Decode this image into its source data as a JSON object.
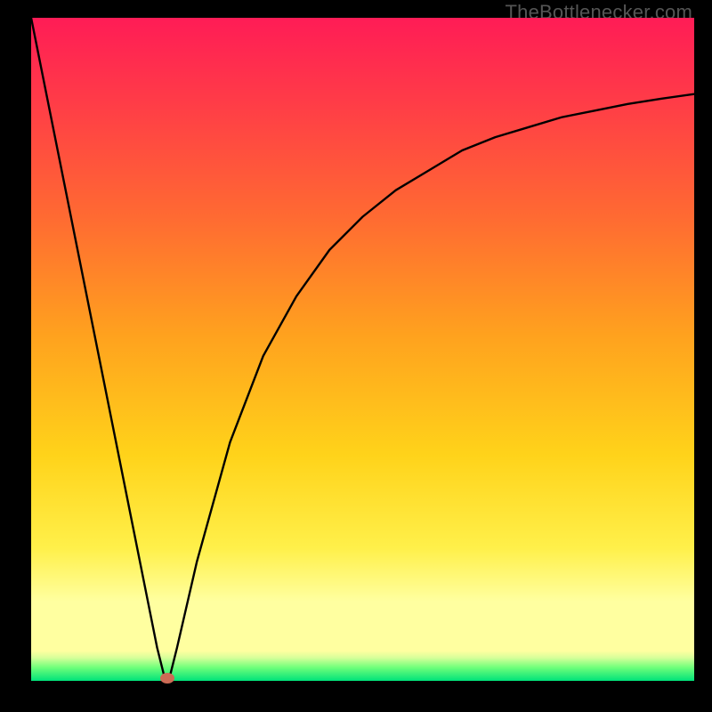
{
  "watermark": "TheBottlenecker.com",
  "chart_data": {
    "type": "line",
    "title": "",
    "xlabel": "",
    "ylabel": "",
    "xlim": [
      0,
      100
    ],
    "ylim": [
      0,
      100
    ],
    "series": [
      {
        "name": "bottleneck-curve",
        "x": [
          0,
          5,
          10,
          15,
          18,
          19,
          20,
          20.5,
          21,
          22,
          25,
          30,
          35,
          40,
          45,
          50,
          55,
          60,
          65,
          70,
          75,
          80,
          85,
          90,
          95,
          100
        ],
        "y": [
          100,
          75,
          50,
          25,
          10,
          5,
          1,
          0,
          1,
          5,
          18,
          36,
          49,
          58,
          65,
          70,
          74,
          77,
          80,
          82,
          83.5,
          85,
          86,
          87,
          87.8,
          88.5
        ]
      }
    ],
    "annotations": [
      {
        "name": "optimal-point",
        "x": 20.5,
        "y": 0
      }
    ],
    "background_gradient": {
      "top": "#ff1c56",
      "mid_upper": "#ff6a32",
      "mid": "#ffd31a",
      "mid_lower": "#ffffa0",
      "bottom": "#00e27a"
    }
  }
}
